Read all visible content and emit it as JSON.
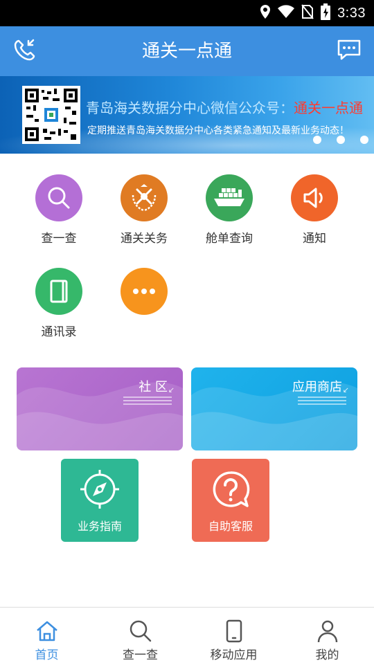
{
  "status_bar": {
    "time": "3:33"
  },
  "header": {
    "title": "通关一点通"
  },
  "banner": {
    "line1_prefix": "青岛海关数据分中心微信公众号：",
    "line1_highlight": "通关一点通",
    "line2": "定期推送青岛海关数据分中心各类紧急通知及最新业务动态！",
    "slide_count": 3
  },
  "grid": {
    "items": [
      {
        "label": "查一查",
        "icon": "search-icon",
        "color": "#b46fd6"
      },
      {
        "label": "通关关务",
        "icon": "customs-emblem-icon",
        "color": "#e07b23"
      },
      {
        "label": "舱单查询",
        "icon": "cargo-ship-icon",
        "color": "#3aa75a"
      },
      {
        "label": "通知",
        "icon": "speaker-icon",
        "color": "#f0652a"
      },
      {
        "label": "通讯录",
        "icon": "address-book-icon",
        "color": "#36b86a"
      },
      {
        "label": "",
        "icon": "more-icon",
        "color": "#f7941d"
      }
    ]
  },
  "cards": {
    "community": {
      "label": "社 区"
    },
    "app_store": {
      "label": "应用商店"
    }
  },
  "tiles": {
    "guide": {
      "label": "业务指南",
      "icon": "compass-icon"
    },
    "service": {
      "label": "自助客服",
      "icon": "help-icon"
    }
  },
  "tabs": [
    {
      "label": "首页",
      "icon": "home-icon",
      "active": true
    },
    {
      "label": "查一查",
      "icon": "search-icon"
    },
    {
      "label": "移动应用",
      "icon": "phone-icon"
    },
    {
      "label": "我的",
      "icon": "user-icon"
    }
  ],
  "colors": {
    "primary": "#3d8fe0",
    "community": "#b46fd6",
    "app_store": "#1aaae8",
    "guide": "#2eb894",
    "service": "#ef6b55"
  }
}
